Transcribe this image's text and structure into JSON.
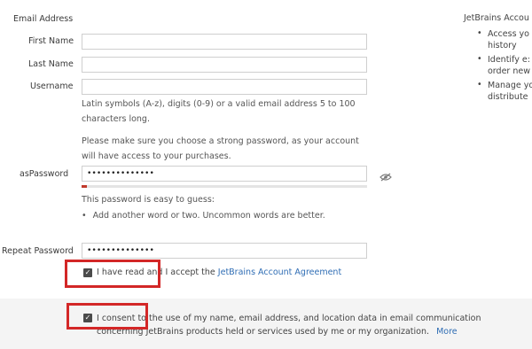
{
  "form": {
    "email_label": "Email Address",
    "first_name": {
      "label": "First Name",
      "value": ""
    },
    "last_name": {
      "label": "Last Name",
      "value": ""
    },
    "username": {
      "label": "Username",
      "value": ""
    },
    "username_hint_1": "Latin symbols (A-z), digits (0-9) or a valid email address 5 to 100",
    "username_hint_2": "characters long.",
    "password_note_1": "Please make sure you choose a strong password, as your account",
    "password_note_2": "will have access to your purchases.",
    "password": {
      "label_prefix": "as",
      "label": "Password",
      "value": "••••••••••••••",
      "strength_fraction": 0.02
    },
    "password_strength_msg": "This password is easy to guess:",
    "password_tip": "Add another word or two. Uncommon words are better.",
    "repeat_password": {
      "label": "Repeat Password",
      "value": "••••••••••••••"
    },
    "agreement": {
      "checked": true,
      "text": "I have read and I accept the",
      "link": "JetBrains Account Agreement"
    },
    "consent": {
      "checked": true,
      "line_1": "I consent to the use of my name, email address, and location data in email communication",
      "line_2": "concerning JetBrains products held or services used by me or my organization.",
      "more": "More"
    }
  },
  "sidebar": {
    "title": "JetBrains Accou",
    "items": [
      {
        "line_1": "Access yo",
        "line_2": "history"
      },
      {
        "line_1": "Identify e:",
        "line_2": "order new"
      },
      {
        "line_1": "Manage yo",
        "line_2": "distribute"
      }
    ]
  },
  "colors": {
    "accent": "#2f6db4",
    "highlight": "#d32727",
    "strength": "#c0392b"
  }
}
